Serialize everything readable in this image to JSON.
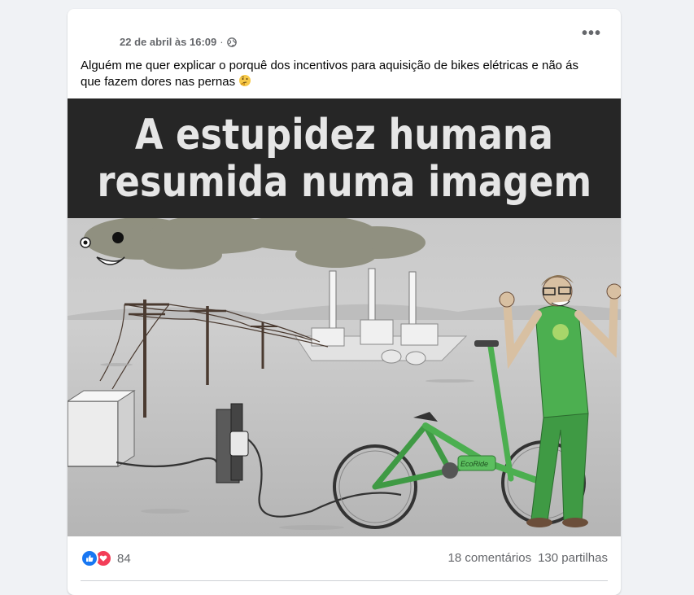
{
  "post": {
    "timestamp": "22 de abril às 16:09",
    "separator": "·",
    "privacy_icon": "globe-icon",
    "more_icon": "more-options-icon",
    "more_label": "•••",
    "text": "Alguém me quer explicar o porquê dos incentivos para aquisição de bikes elétricas e não ás que fazem dores nas pernas",
    "text_emoji": "thinking-face-emoji"
  },
  "image": {
    "banner_line1": "A estupidez humana",
    "banner_line2": "resumida numa imagem",
    "bike_label": "EcoRide"
  },
  "footer": {
    "reaction_icons": [
      "like-icon",
      "love-icon"
    ],
    "reaction_count": "84",
    "comments": "18 comentários",
    "shares": "130 partilhas"
  },
  "colors": {
    "page_bg": "#f0f2f5",
    "card_bg": "#ffffff",
    "secondary_text": "#65676b",
    "like_blue": "#1877f2",
    "love_red": "#f33e58",
    "banner_bg": "#262626",
    "bike_green": "#4caf50"
  }
}
